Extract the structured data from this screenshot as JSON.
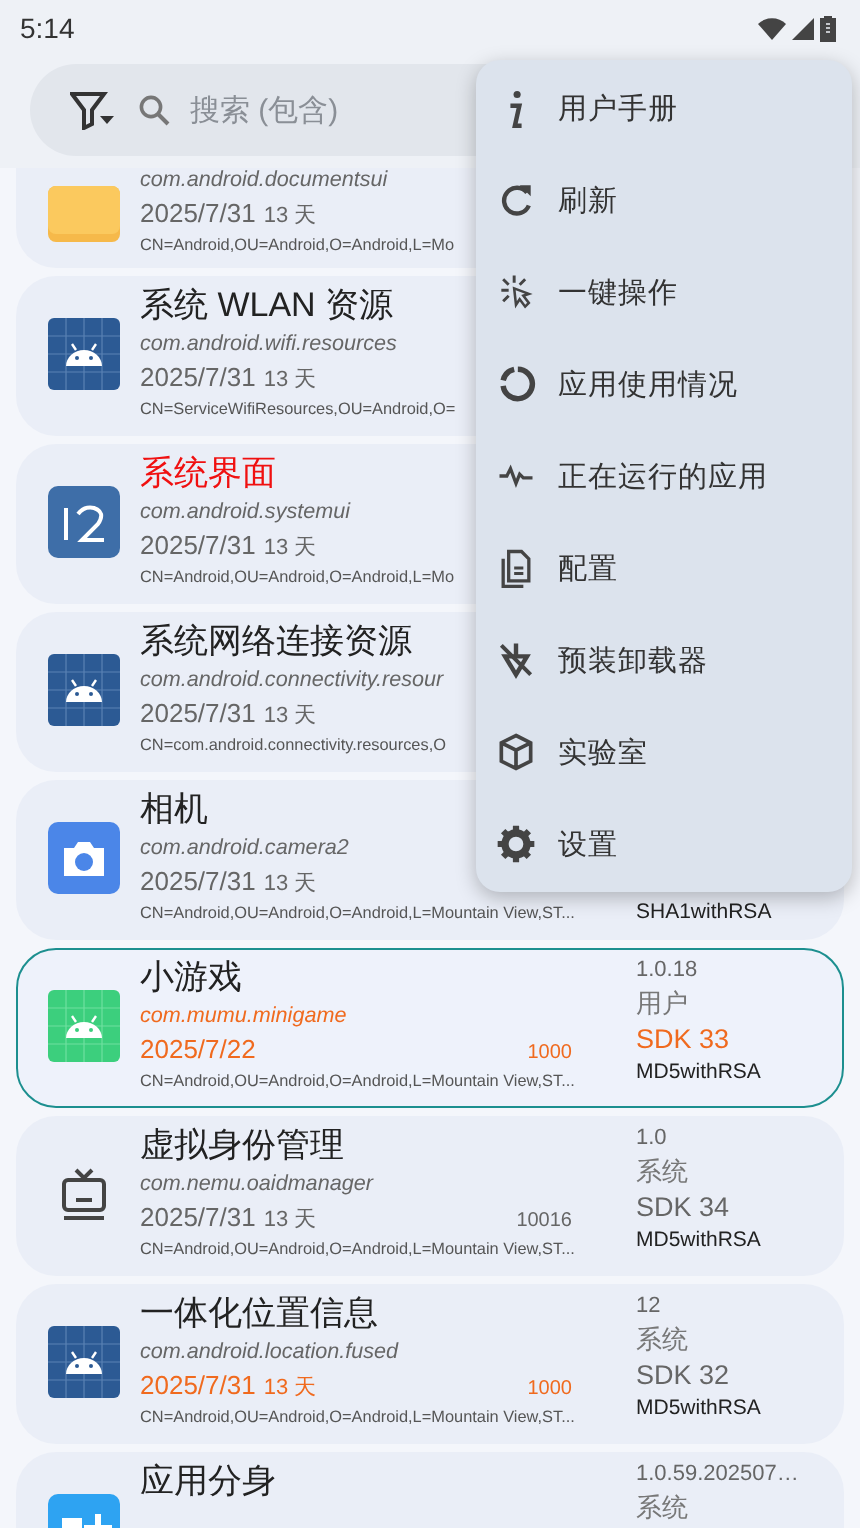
{
  "status_bar": {
    "time": "5:14"
  },
  "search": {
    "placeholder": "搜索 (包含)"
  },
  "apps": [
    {
      "kind": "folder",
      "package": "com.android.documentsui",
      "package_changed": false,
      "date": "2025/7/31",
      "date_changed": false,
      "days": "13 天",
      "cert": "CN=Android,OU=Android,O=Android,L=Mo",
      "selected": false
    },
    {
      "kind": "android-blue",
      "title": "系统 WLAN 资源",
      "title_alert": false,
      "package": "com.android.wifi.resources",
      "package_changed": false,
      "date": "2025/7/31",
      "date_changed": false,
      "days": "13 天",
      "cert": "CN=ServiceWifiResources,OU=Android,O=",
      "selected": false
    },
    {
      "kind": "twelve",
      "title": "系统界面",
      "title_alert": true,
      "package": "com.android.systemui",
      "package_changed": false,
      "date": "2025/7/31",
      "date_changed": false,
      "days": "13 天",
      "cert": "CN=Android,OU=Android,O=Android,L=Mo",
      "selected": false
    },
    {
      "kind": "android-blue",
      "title": "系统网络连接资源",
      "title_alert": false,
      "package": "com.android.connectivity.resour",
      "package_changed": false,
      "date": "2025/7/31",
      "date_changed": false,
      "days": "13 天",
      "cert": "CN=com.android.connectivity.resources,O",
      "selected": false
    },
    {
      "kind": "camera",
      "title": "相机",
      "title_alert": false,
      "package": "com.android.camera2",
      "package_changed": false,
      "date": "2025/7/31",
      "date_changed": false,
      "days": "13 天",
      "cert": "CN=Android,OU=Android,O=Android,L=Mountain View,ST...",
      "signature": "SHA1withRSA",
      "selected": false
    },
    {
      "kind": "android-green",
      "title": "小游戏",
      "title_alert": false,
      "package": "com.mumu.minigame",
      "package_changed": true,
      "date": "2025/7/22",
      "date_changed": true,
      "uid": "1000",
      "uid_changed": true,
      "cert": "CN=Android,OU=Android,O=Android,L=Mountain View,ST...",
      "version": "1.0.18",
      "type": "用户",
      "sdk": "SDK 33",
      "sdk_changed": true,
      "signature": "MD5withRSA",
      "selected": true
    },
    {
      "kind": "tv",
      "title": "虚拟身份管理",
      "title_alert": false,
      "package": "com.nemu.oaidmanager",
      "package_changed": false,
      "date": "2025/7/31",
      "date_changed": false,
      "days": "13 天",
      "uid": "10016",
      "uid_changed": false,
      "cert": "CN=Android,OU=Android,O=Android,L=Mountain View,ST...",
      "version": "1.0",
      "type": "系统",
      "sdk": "SDK 34",
      "sdk_changed": false,
      "signature": "MD5withRSA",
      "selected": false
    },
    {
      "kind": "android-blue",
      "title": "一体化位置信息",
      "title_alert": false,
      "package": "com.android.location.fused",
      "package_changed": false,
      "date": "2025/7/31",
      "date_changed": true,
      "days": "13 天",
      "uid": "1000",
      "uid_changed": true,
      "cert": "CN=Android,OU=Android,O=Android,L=Mountain View,ST...",
      "version": "12",
      "type": "系统",
      "sdk": "SDK 32",
      "sdk_changed": false,
      "signature": "MD5withRSA",
      "selected": false
    },
    {
      "kind": "clone",
      "title": "应用分身",
      "title_alert": false,
      "version": "1.0.59.202507…",
      "type": "系统",
      "selected": false
    }
  ],
  "menu": [
    {
      "kind": "info",
      "label": "用户手册"
    },
    {
      "kind": "refresh",
      "label": "刷新"
    },
    {
      "kind": "click",
      "label": "一键操作"
    },
    {
      "kind": "ring",
      "label": "应用使用情况"
    },
    {
      "kind": "pulse",
      "label": "正在运行的应用"
    },
    {
      "kind": "document",
      "label": "配置"
    },
    {
      "kind": "uninstall",
      "label": "预装卸载器"
    },
    {
      "kind": "cube",
      "label": "实验室"
    },
    {
      "kind": "gear",
      "label": "设置"
    }
  ]
}
